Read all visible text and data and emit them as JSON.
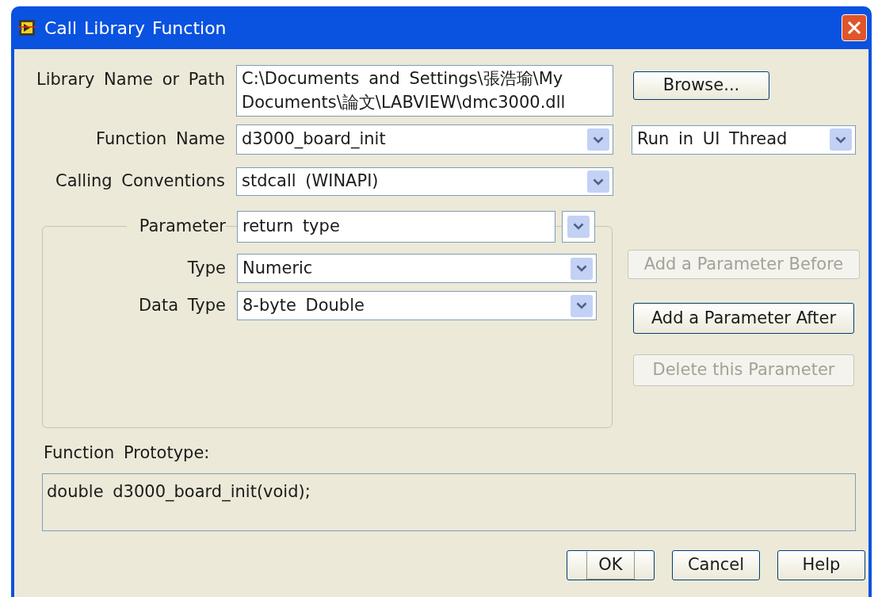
{
  "window": {
    "title": "Call Library Function"
  },
  "library_path": {
    "label": "Library Name or Path",
    "value": "C:\\Documents and Settings\\張浩瑜\\My Documents\\論文\\LABVIEW\\dmc3000.dll"
  },
  "browse_button": {
    "label": "Browse...",
    "disabled": false
  },
  "function_name": {
    "label": "Function Name",
    "value": "d3000_board_init"
  },
  "thread": {
    "value": "Run in UI Thread"
  },
  "calling_conventions": {
    "label": "Calling Conventions",
    "value": "stdcall (WINAPI)"
  },
  "parameter_group": {
    "parameter": {
      "label": "Parameter",
      "value": "return type"
    },
    "fields": [
      {
        "label": "Type",
        "value": "Numeric"
      },
      {
        "label": "Data Type",
        "value": "8-byte Double"
      }
    ]
  },
  "parameter_buttons": [
    {
      "label": "Add a Parameter Before",
      "disabled": true
    },
    {
      "label": "Add a Parameter After",
      "disabled": false
    },
    {
      "label": "Delete this Parameter",
      "disabled": true
    }
  ],
  "prototype": {
    "label": "Function Prototype:",
    "text": "double d3000_board_init(void);"
  },
  "buttons": [
    {
      "label": "OK",
      "focused": true
    },
    {
      "label": "Cancel",
      "focused": false
    },
    {
      "label": "Help",
      "focused": false
    }
  ]
}
